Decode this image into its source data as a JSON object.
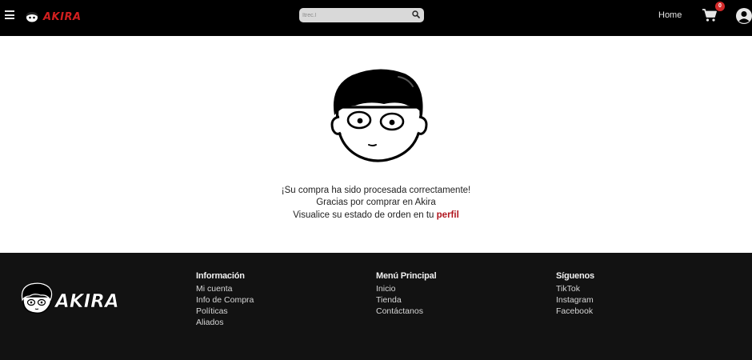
{
  "header": {
    "brand_text": "AKIRA",
    "search_placeholder": "Itrec.l",
    "home_label": "Home",
    "cart_count": "0",
    "brand_color": "#d11f1f",
    "badge_color": "#d32a2a"
  },
  "icons": {
    "menu": "hamburger-menu-icon",
    "search": "magnifier-search-icon",
    "cart": "shopping-cart-icon",
    "user": "user-account-icon"
  },
  "main": {
    "line1": "¡Su compra ha sido procesada correctamente!",
    "line2": "Gracias por comprar en Akira",
    "line3_prefix": "Visualice su estado de orden en tu ",
    "profile_link": "perfil",
    "link_color": "#b0151e"
  },
  "footer": {
    "logo_text": "AKIRA",
    "columns": [
      {
        "title": "Información",
        "links": [
          "Mi cuenta",
          "Info de Compra",
          "Políticas",
          "Aliados"
        ]
      },
      {
        "title": "Menú Principal",
        "links": [
          "Inicio",
          "Tienda",
          "Contáctanos"
        ]
      },
      {
        "title": "Síguenos",
        "links": [
          "TikTok",
          "Instagram",
          "Facebook"
        ]
      }
    ]
  }
}
